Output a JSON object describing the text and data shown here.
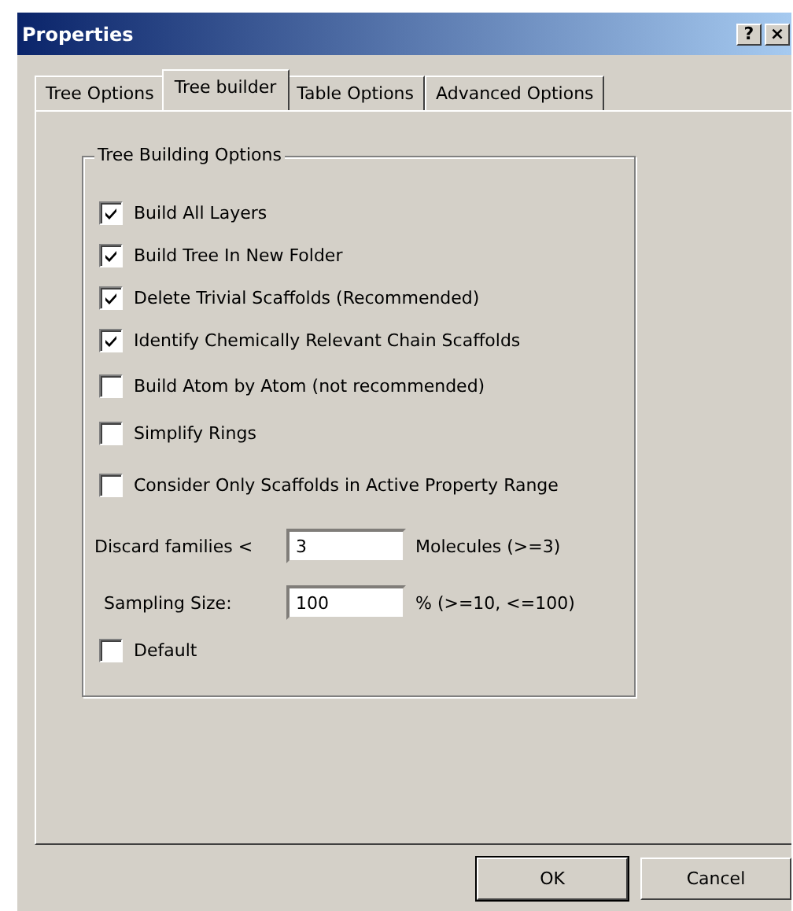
{
  "window": {
    "title": "Properties",
    "title_buttons": [
      "?",
      "×"
    ]
  },
  "tabs": [
    {
      "label": "Tree Options",
      "selected": false
    },
    {
      "label": "Tree builder",
      "selected": true
    },
    {
      "label": "Table Options",
      "selected": false
    },
    {
      "label": "Advanced Options",
      "selected": false
    }
  ],
  "group": {
    "title": "Tree Building Options",
    "checkboxes": [
      {
        "label": "Build All Layers",
        "checked": true
      },
      {
        "label": "Build Tree In New Folder",
        "checked": true
      },
      {
        "label": "Delete Trivial Scaffolds (Recommended)",
        "checked": true
      },
      {
        "label": "Identify Chemically Relevant Chain Scaffolds",
        "checked": true
      },
      {
        "label": "Build Atom by Atom (not recommended)",
        "checked": false
      },
      {
        "label": "Simplify Rings",
        "checked": false
      },
      {
        "label": "Consider Only Scaffolds in Active Property Range",
        "checked": false
      }
    ],
    "fields": [
      {
        "label": "Discard families <",
        "value": "3",
        "hint": "Molecules (>=3)"
      },
      {
        "label": "Sampling Size:",
        "value": "100",
        "hint": "% (>=10, <=100)"
      }
    ],
    "default": {
      "label": "Default",
      "checked": false
    }
  },
  "buttons": [
    "OK",
    "Cancel"
  ]
}
